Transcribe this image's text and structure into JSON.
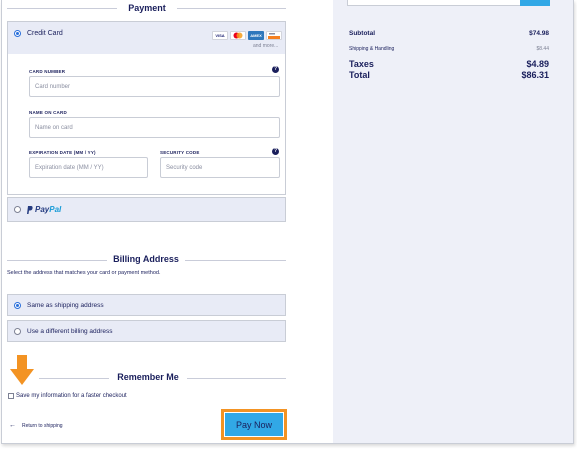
{
  "payment": {
    "title": "Payment",
    "credit_card": {
      "label": "Credit Card",
      "brands": [
        "VISA",
        "MC",
        "AMEX",
        "DISC"
      ],
      "more_label": "and more...",
      "card_number": {
        "label": "CARD NUMBER",
        "placeholder": "Card number"
      },
      "name_on_card": {
        "label": "NAME ON CARD",
        "placeholder": "Name on card"
      },
      "expiration": {
        "label": "EXPIRATION DATE (MM / YY)",
        "placeholder": "Expiration date (MM / YY)"
      },
      "security_code": {
        "label": "SECURITY CODE",
        "placeholder": "Security code"
      },
      "help_glyph": "?"
    },
    "paypal": {
      "label_a": "Pay",
      "label_b": "Pal"
    }
  },
  "billing": {
    "title": "Billing Address",
    "description": "Select the address that matches your card or payment method.",
    "options": [
      {
        "label": "Same as shipping address",
        "selected": true
      },
      {
        "label": "Use a different billing address",
        "selected": false
      }
    ]
  },
  "remember": {
    "title": "Remember Me",
    "checkbox_label": "Save my information for a faster checkout",
    "checked": false
  },
  "footer": {
    "back_label": "Return to shipping",
    "back_arrow": "←",
    "pay_label": "Pay Now"
  },
  "summary": {
    "subtotal_label": "Subtotal",
    "subtotal_value": "$74.98",
    "shipping_label": "Shipping & Handling",
    "shipping_value": "$8.44",
    "taxes_label": "Taxes",
    "taxes_value": "$4.89",
    "total_label": "Total",
    "total_value": "$86.31"
  },
  "colors": {
    "accent": "#31a8e6",
    "highlight": "#f39323",
    "text": "#1a1f5c",
    "panel": "#eef0f8"
  }
}
